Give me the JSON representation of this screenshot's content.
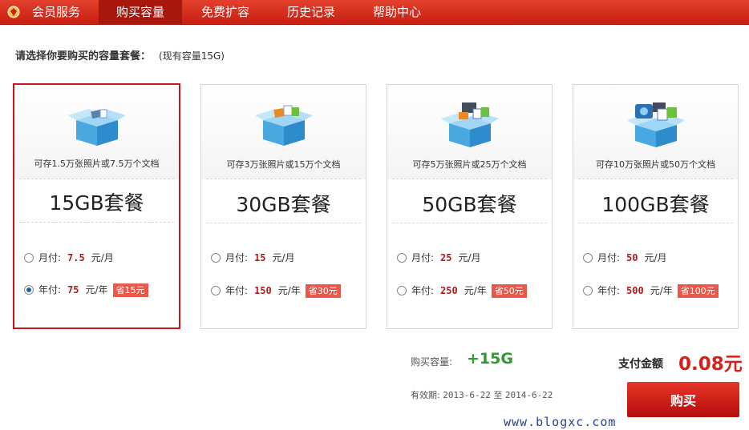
{
  "nav": {
    "items": [
      {
        "label": "会员服务"
      },
      {
        "label": "购买容量",
        "active": true
      },
      {
        "label": "免费扩容"
      },
      {
        "label": "历史记录"
      },
      {
        "label": "帮助中心"
      }
    ]
  },
  "prompt": {
    "text": "请选择你要购买的容量套餐：",
    "current": "(现有容量15G)"
  },
  "packages": [
    {
      "desc": "可存1.5万张照片或7.5万个文档",
      "title": "15GB套餐",
      "selected": true,
      "monthly": {
        "label": "月付:",
        "price": "7.5",
        "unit": "元/月",
        "checked": false
      },
      "yearly": {
        "label": "年付:",
        "price": "75",
        "unit": "元/年",
        "save": "省15元",
        "checked": true
      }
    },
    {
      "desc": "可存3万张照片或15万个文档",
      "title": "30GB套餐",
      "selected": false,
      "monthly": {
        "label": "月付:",
        "price": "15",
        "unit": "元/月",
        "checked": false
      },
      "yearly": {
        "label": "年付:",
        "price": "150",
        "unit": "元/年",
        "save": "省30元",
        "checked": false
      }
    },
    {
      "desc": "可存5万张照片或25万个文档",
      "title": "50GB套餐",
      "selected": false,
      "monthly": {
        "label": "月付:",
        "price": "25",
        "unit": "元/月",
        "checked": false
      },
      "yearly": {
        "label": "年付:",
        "price": "250",
        "unit": "元/年",
        "save": "省50元",
        "checked": false
      }
    },
    {
      "desc": "可存10万张照片或50万个文档",
      "title": "100GB套餐",
      "selected": false,
      "monthly": {
        "label": "月付:",
        "price": "50",
        "unit": "元/月",
        "checked": false
      },
      "yearly": {
        "label": "年付:",
        "price": "500",
        "unit": "元/年",
        "save": "省100元",
        "checked": false
      }
    }
  ],
  "summary": {
    "capacity_label": "购买容量:",
    "capacity_value": "+15G",
    "valid_label": "有效期:",
    "valid_from": "2013-6-22",
    "valid_to_word": "至",
    "valid_to": "2014-6-22",
    "pay_label": "支付金额",
    "pay_amount": "0.08元",
    "buy_label": "购买"
  },
  "watermark": "www.blogxc.com",
  "colors": {
    "nav_bg": "#d42a1a",
    "nav_active": "#a9160c",
    "selected_border": "#c8161d",
    "price_red": "#b31b1b",
    "save_badge": "#e8594c",
    "capacity_green": "#2d9b2d",
    "amount_red": "#d2231b"
  }
}
